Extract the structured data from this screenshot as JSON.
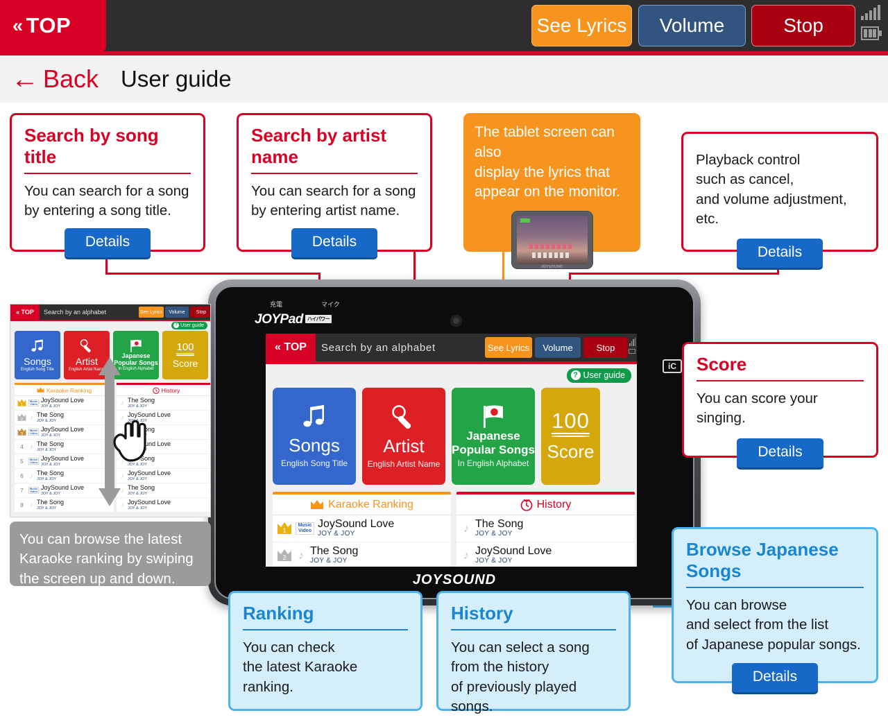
{
  "header": {
    "top_button": "TOP",
    "top_chevron": "«",
    "see_lyrics": "See Lyrics",
    "volume": "Volume",
    "stop": "Stop",
    "signal_icon": "signal-bars-icon",
    "battery_icon": "battery-icon"
  },
  "subheader": {
    "back_arrow": "←",
    "back_label": "Back",
    "page_title": "User guide"
  },
  "callouts": {
    "song_title": {
      "title": "Search by song title",
      "body": "You can search for a song\nby entering a song title.",
      "details": "Details"
    },
    "artist_name": {
      "title": "Search by artist name",
      "body": "You can search for a song\nby entering artist name.",
      "details": "Details"
    },
    "tablet_lyrics": {
      "body": "The tablet screen can also\ndisplay the lyrics that\nappear on the monitor."
    },
    "playback": {
      "body": "Playback control\nsuch as cancel,\nand volume adjustment, etc.",
      "details": "Details"
    },
    "score": {
      "title": "Score",
      "body": "You can score your singing.",
      "details": "Details"
    },
    "browse_japanese": {
      "title": "Browse Japanese Songs",
      "body": "You can browse\nand select from the list\nof Japanese popular songs.",
      "details": "Details"
    },
    "ranking": {
      "title": "Ranking",
      "body": "You can check\nthe latest Karaoke ranking."
    },
    "history": {
      "title": "History",
      "body": "You can select a song\nfrom the history\nof previously played songs."
    },
    "swipe_note": {
      "body": "You can browse the latest\nKaraoke ranking by swiping\nthe screen up and down."
    }
  },
  "device": {
    "label_charge": "充電",
    "label_mic": "マイク",
    "logo": "JOYPad",
    "logo_badge": "ハイパワー",
    "ic_badge": "iC",
    "footer_brand": "JOYSOUND",
    "camera_icon": "camera-icon"
  },
  "screen": {
    "top_button": "« TOP",
    "search_placeholder": "Search by an alphabet",
    "see_lyrics": "See Lyrics",
    "volume": "Volume",
    "stop": "Stop",
    "user_guide": "User guide",
    "user_guide_mark": "?",
    "tiles": [
      {
        "name": "Songs",
        "sub": "English Song Title",
        "icon": "music-note-icon",
        "color": "#3367cc"
      },
      {
        "name": "Artist",
        "sub": "English Artist Name",
        "icon": "microphone-icon",
        "color": "#dd1f26"
      },
      {
        "name": "Japanese\nPopular Songs",
        "sub": "In English Alphabet",
        "icon": "japan-flag-icon",
        "color": "#22a447"
      },
      {
        "name": "Score",
        "sub": "100",
        "icon": "score-100-icon",
        "color": "#d4a80b"
      }
    ],
    "ranking_panel": {
      "title": "Karaoke Ranking",
      "icon": "crown-icon",
      "rows": [
        {
          "rank": "1",
          "title": "JoySound Love",
          "artist": "JOY & JOY",
          "badge": "Music Video"
        },
        {
          "rank": "2",
          "title": "The Song",
          "artist": "JOY & JOY",
          "badge": "note"
        }
      ]
    },
    "history_panel": {
      "title": "History",
      "icon": "clock-icon",
      "rows": [
        {
          "title": "The Song",
          "artist": "JOY & JOY"
        },
        {
          "title": "JoySound Love",
          "artist": "JOY & JOY"
        }
      ]
    }
  },
  "mini_shot": {
    "top_button": "« TOP",
    "search_placeholder": "Search by an alphabet",
    "see_lyrics": "See Lyrics",
    "volume": "Volume",
    "stop": "Stop",
    "user_guide": "User guide",
    "tiles": [
      {
        "name": "Songs",
        "sub": "English Song Title"
      },
      {
        "name": "Artist",
        "sub": "English Artist Name"
      },
      {
        "name": "Japanese\nPopular Songs",
        "sub": "In English Alphabet"
      },
      {
        "name": "Score",
        "sub": "100"
      }
    ],
    "ranking_title": "Karaoke Ranking",
    "history_title": "History",
    "ranking_rows": [
      {
        "rank": "1",
        "title": "JoySound Love",
        "artist": "JOY & JOY",
        "badge": "mv"
      },
      {
        "rank": "2",
        "title": "The Song",
        "artist": "JOY & JOY",
        "badge": "note"
      },
      {
        "rank": "3",
        "title": "JoySound Love",
        "artist": "JOY & JOY",
        "badge": "mv"
      },
      {
        "rank": "4",
        "title": "The Song",
        "artist": "JOY & JOY",
        "badge": "note"
      },
      {
        "rank": "5",
        "title": "JoySound Love",
        "artist": "JOY & JOY",
        "badge": "mv"
      },
      {
        "rank": "6",
        "title": "The Song",
        "artist": "JOY & JOY",
        "badge": "note"
      },
      {
        "rank": "7",
        "title": "JoySound Love",
        "artist": "JOY & JOY",
        "badge": "mv"
      },
      {
        "rank": "8",
        "title": "The Song",
        "artist": "JOY & JOY",
        "badge": "note"
      }
    ],
    "history_rows": [
      {
        "title": "The Song",
        "artist": "JOY & JOY"
      },
      {
        "title": "JoySound Love",
        "artist": "JOY & JOY"
      },
      {
        "title": "The Song",
        "artist": "JOY & JOY"
      },
      {
        "title": "JoySound Love",
        "artist": "JOY & JOY"
      },
      {
        "title": "The Song",
        "artist": "JOY & JOY"
      },
      {
        "title": "JoySound Love",
        "artist": "JOY & JOY"
      },
      {
        "title": "The Song",
        "artist": "JOY & JOY"
      },
      {
        "title": "JoySound Love",
        "artist": "JOY & JOY"
      }
    ],
    "swipe_icon": "hand-swipe-icon",
    "arrow_icon": "up-down-arrow-icon"
  },
  "colors": {
    "brand_red": "#d80024",
    "orange": "#f7941e",
    "blue_accent": "#4db3ef",
    "details_blue": "#1669c6",
    "green": "#22a447",
    "gold": "#d4a80b"
  }
}
